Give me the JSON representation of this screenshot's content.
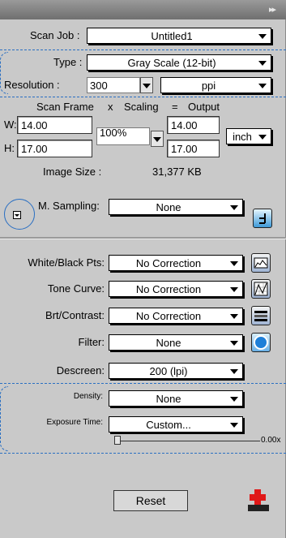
{
  "scan_job": {
    "label": "Scan Job :",
    "value": "Untitled1"
  },
  "type": {
    "label": "Type :",
    "value": "Gray Scale (12-bit)"
  },
  "resolution": {
    "label": "Resolution :",
    "value": "300",
    "unit": "ppi"
  },
  "frame_header": {
    "scan_frame": "Scan Frame",
    "x": "x",
    "scaling": "Scaling",
    "eq": "=",
    "output": "Output"
  },
  "frame": {
    "w_label": "W:",
    "w_value": "14.00",
    "h_label": "H:",
    "h_value": "17.00",
    "scaling_value": "100%",
    "out_w": "14.00",
    "out_h": "17.00",
    "unit": "inch"
  },
  "image_size": {
    "label": "Image Size :",
    "value": "31,377 KB"
  },
  "m_sampling": {
    "label": "M. Sampling:",
    "value": "None"
  },
  "white_black": {
    "label": "White/Black Pts:",
    "value": "No Correction"
  },
  "tone_curve": {
    "label": "Tone Curve:",
    "value": "No Correction"
  },
  "brt_contrast": {
    "label": "Brt/Contrast:",
    "value": "No Correction"
  },
  "filter": {
    "label": "Filter:",
    "value": "None"
  },
  "descreen": {
    "label": "Descreen:",
    "value": "200 (lpi)"
  },
  "density": {
    "label": "Density:",
    "value": "None"
  },
  "exposure": {
    "label": "Exposure Time:",
    "value": "Custom...",
    "slider_value": "0.00x",
    "slider_level": 0
  },
  "reset_label": "Reset",
  "colors": {
    "panel": "#c9c9c9",
    "titlebar": "#7a7a7a",
    "annotation": "#2a6fc2"
  }
}
